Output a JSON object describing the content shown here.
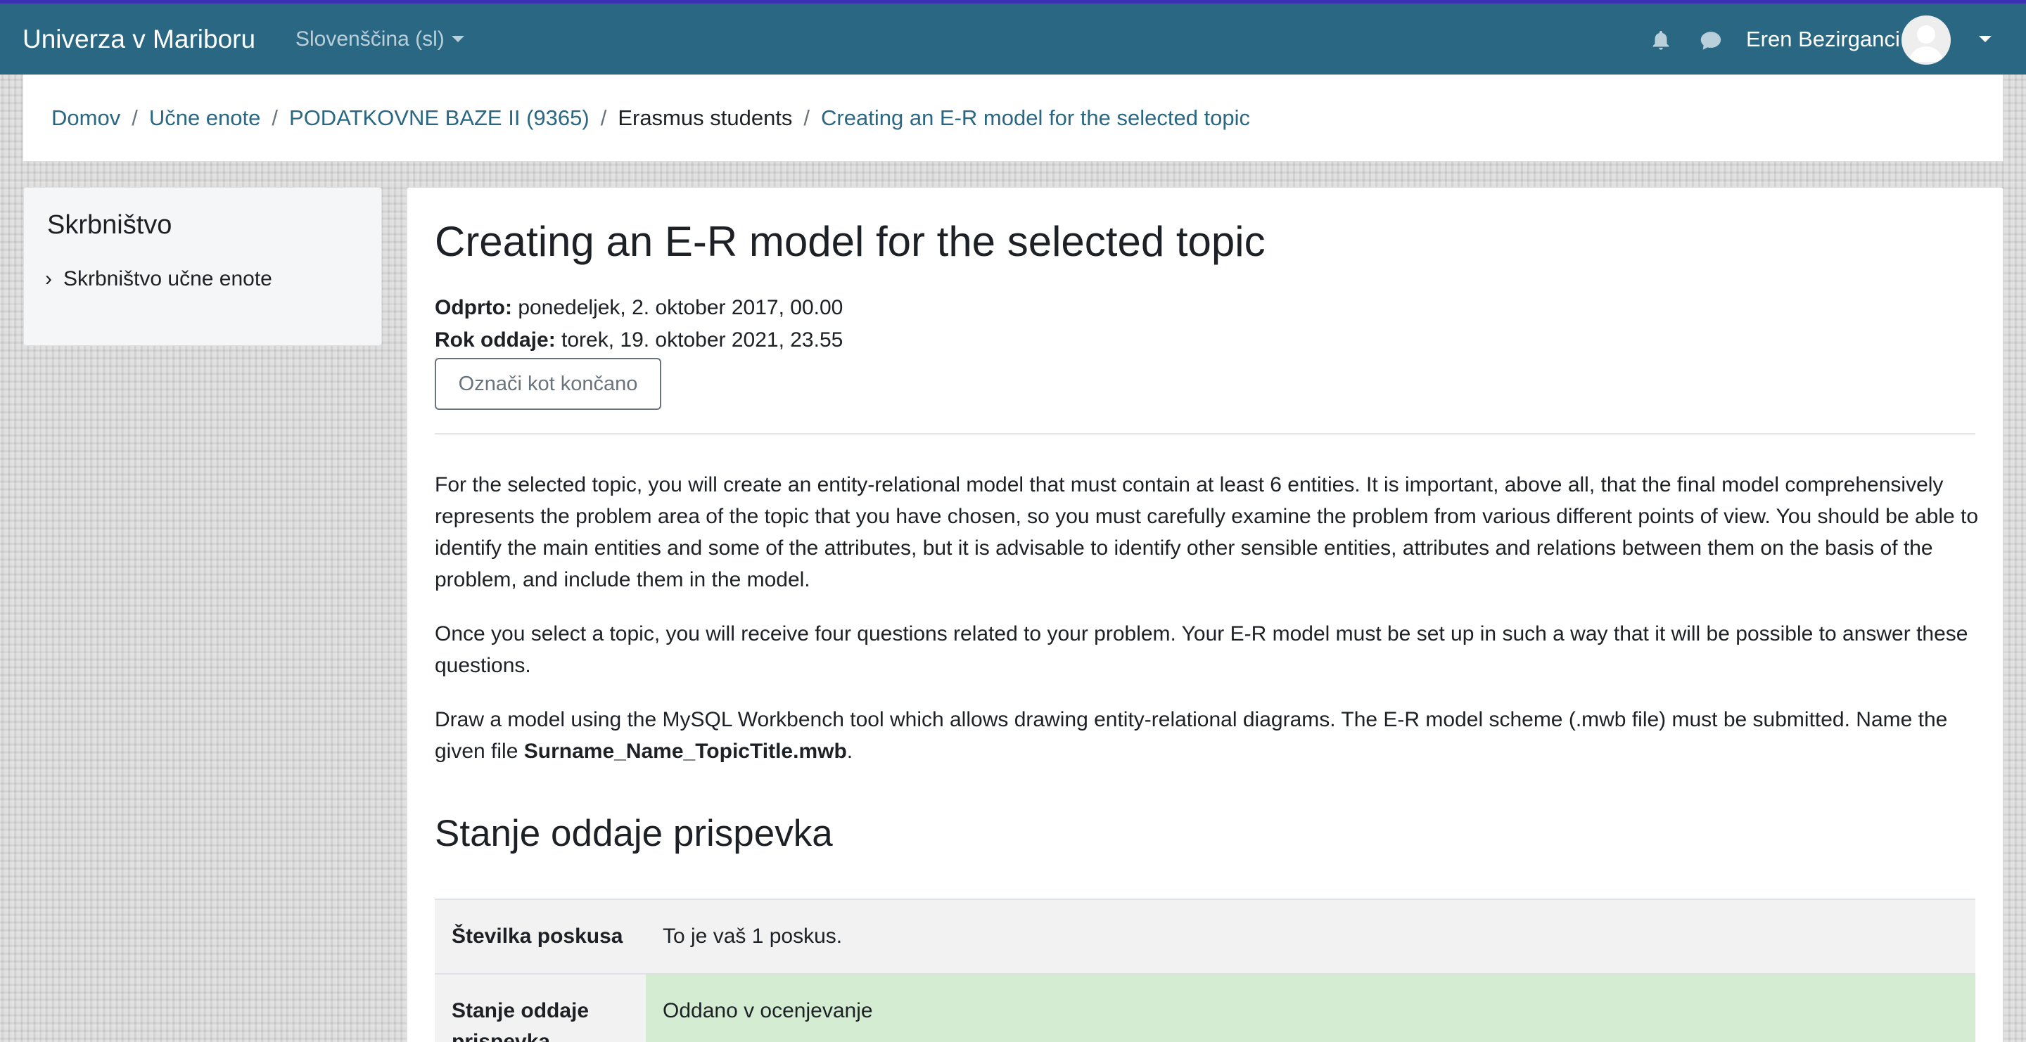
{
  "navbar": {
    "brand": "Univerza v Mariboru",
    "language": "Slovenščina (sl)",
    "user_name": "Eren Bezirganci",
    "icons": [
      "bell-icon",
      "chat-icon",
      "chevron-down-icon"
    ],
    "colors": {
      "navbar_bg": "#2a6782",
      "accent_strip": "#3a2fb0"
    }
  },
  "breadcrumb": {
    "items": [
      {
        "label": "Domov",
        "link": true
      },
      {
        "label": "Učne enote",
        "link": true
      },
      {
        "label": "PODATKOVNE BAZE II (9365)",
        "link": true
      },
      {
        "label": "Erasmus students",
        "link": false
      },
      {
        "label": "Creating an E-R model for the selected topic",
        "link": true
      }
    ]
  },
  "sidebar": {
    "title": "Skrbništvo",
    "item": "Skrbništvo učne enote"
  },
  "main": {
    "title": "Creating an E-R model for the selected topic",
    "open_label": "Odprto:",
    "open_value": "ponedeljek, 2. oktober 2017, 00.00",
    "due_label": "Rok oddaje:",
    "due_value": "torek, 19. oktober 2021, 23.55",
    "mark_done_button": "Označi kot končano",
    "paragraph1": "For the selected topic, you will create an entity-relational model that must contain at least 6 entities. It is important, above all, that the final model comprehensively represents the problem area of the topic that you have chosen, so you must carefully examine the problem from various different points of view. You should be able to identify the main entities and some of the attributes, but it is advisable to identify other sensible entities, attributes and relations between them on the basis of the problem, and include them in the model.",
    "paragraph2": "Once you select a topic, you will receive four questions related to your problem. Your E-R model must be set up in such a way that it will be possible to answer these questions.",
    "paragraph3_prefix": "Draw a model using the MySQL Workbench tool which allows drawing entity-relational diagrams. The E-R model scheme (.mwb file) must be submitted. Name the given file ",
    "paragraph3_filename": "Surname_Name_TopicTitle.mwb",
    "paragraph3_suffix": ".",
    "status_heading": "Stanje oddaje prispevka",
    "status_table": [
      {
        "label": "Številka poskusa",
        "value": "To je vaš 1 poskus."
      },
      {
        "label": "Stanje oddaje prispevka",
        "value": "Oddano v ocenjevanje"
      }
    ],
    "colors": {
      "submitted_bg": "#d4edd2",
      "link": "#2a6782"
    }
  }
}
